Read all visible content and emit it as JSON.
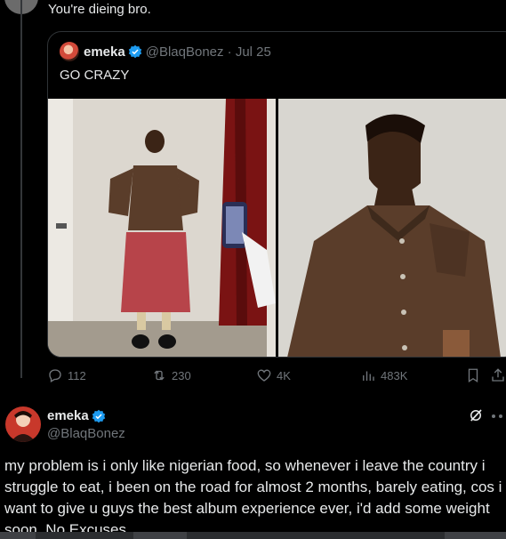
{
  "reply": {
    "text": "You're dieing bro."
  },
  "quote": {
    "name": "emeka",
    "handle": "@BlaqBonez",
    "date": "Jul 25",
    "text": "GO CRAZY"
  },
  "actions": {
    "replies": "112",
    "reposts": "230",
    "likes": "4K",
    "views": "483K"
  },
  "tweet": {
    "name": "emeka",
    "handle": "@BlaqBonez",
    "body": "my problem is i only like nigerian food, so whenever i leave the country i struggle to eat, i been on the road for almost 2 months, barely eating, cos i want to give u guys the best album experience ever, i'd add some weight soon. No Excuses"
  },
  "icons": {
    "reply": "reply-icon",
    "repost": "repost-icon",
    "like": "heart-icon",
    "views": "views-icon",
    "bookmark": "bookmark-icon",
    "share": "share-icon",
    "verified": "verified-badge-icon",
    "grok": "grok-icon"
  },
  "colors": {
    "background": "#000000",
    "text": "#e7e9ea",
    "muted": "#71767b",
    "verified": "#1d9bf0",
    "border": "#2f3336"
  }
}
